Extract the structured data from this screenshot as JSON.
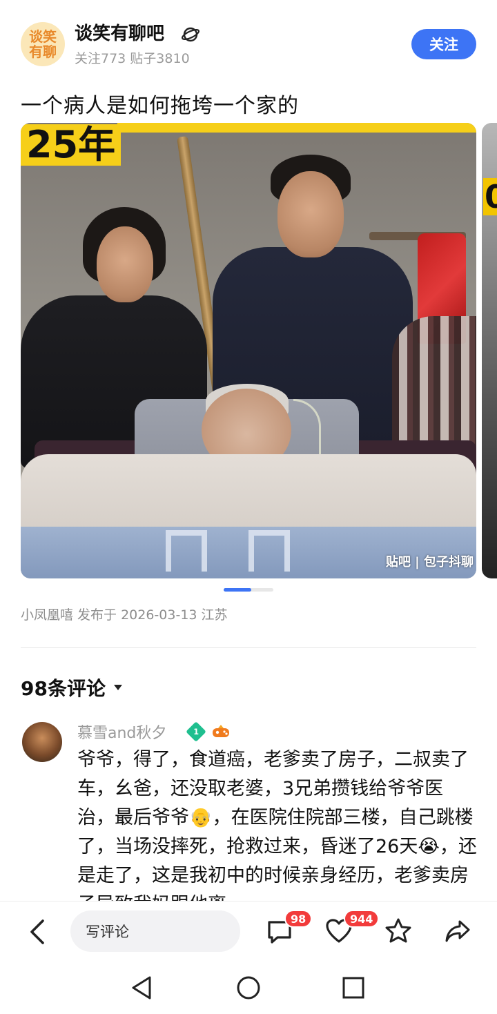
{
  "forum": {
    "avatar_text": "谈笑\n有聊",
    "name": "谈笑有聊吧",
    "badge_icon": "planet-icon",
    "stats": "关注773 贴子3810",
    "follow_label": "关注",
    "accent": "#3d74f5"
  },
  "post": {
    "title": "一个病人是如何拖垮一个家的",
    "image": {
      "overlay_text": "25年",
      "next_peek_text": "0",
      "watermark": "贴吧 | 包子抖聊"
    },
    "pager": {
      "current": 1,
      "total": 2
    },
    "meta": "小凤凰嘻 发布于 2026-03-13 江苏"
  },
  "comments": {
    "count_label": "98条评论",
    "items": [
      {
        "author": "慕雪and秋夕",
        "level": "1",
        "extra_icon": "game-controller-icon",
        "text": "爷爷，得了，食道癌，老爹卖了房子，二叔卖了车，幺爸，还没取老婆，3兄弟攒钱给爷爷医治，最后爷爷👴，在医院住院部三楼，自己跳楼了，当场没摔死，抢救过来，昏迷了26天😭，还是走了，这是我初中的时候亲身经历，老爹卖房子导致我妈跟他离"
      }
    ]
  },
  "action_bar": {
    "input_placeholder": "写评论",
    "comment_count": "98",
    "like_count": "944",
    "badge_color": "#f23b3b"
  }
}
